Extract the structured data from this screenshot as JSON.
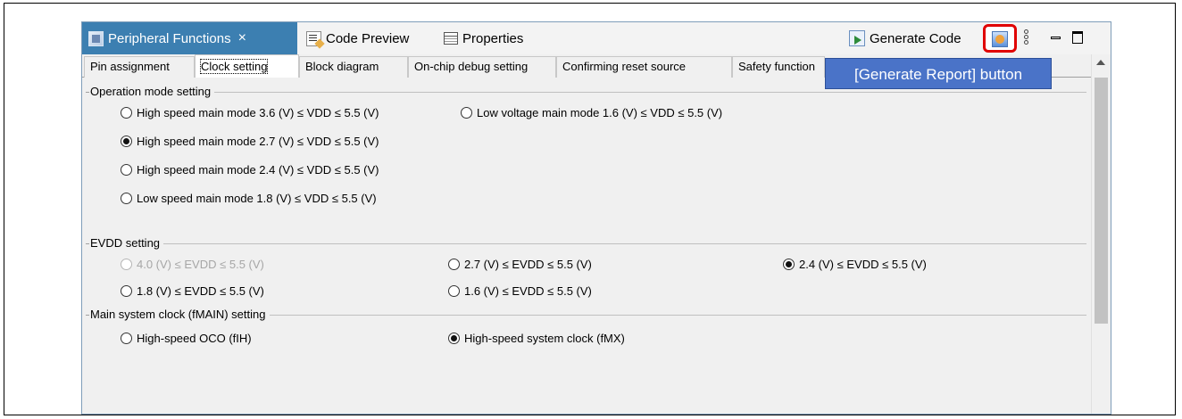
{
  "view_tabs": {
    "peripheral_functions": "Peripheral Functions",
    "close_glyph": "×",
    "code_preview": "Code Preview",
    "properties": "Properties"
  },
  "toolbar": {
    "generate_code": "Generate Code"
  },
  "tooltip": "[Generate Report] button",
  "inner_tabs": [
    {
      "label": "Pin assignment"
    },
    {
      "label": "Clock setting",
      "active": true
    },
    {
      "label": "Block diagram"
    },
    {
      "label": "On-chip debug setting"
    },
    {
      "label": "Confirming reset source"
    },
    {
      "label": "Safety function"
    }
  ],
  "groups": {
    "operation_mode": {
      "title": "Operation mode setting",
      "options": [
        {
          "label": "High speed main mode 3.6 (V) ≤ VDD ≤ 5.5 (V)",
          "checked": false
        },
        {
          "label": "Low voltage main mode 1.6 (V) ≤ VDD ≤ 5.5 (V)",
          "checked": false
        },
        {
          "label": "High speed main mode 2.7 (V) ≤ VDD ≤ 5.5 (V)",
          "checked": true
        },
        {
          "label": "High speed main mode 2.4 (V) ≤ VDD ≤ 5.5 (V)",
          "checked": false
        },
        {
          "label": "Low speed main mode 1.8 (V) ≤ VDD ≤ 5.5 (V)",
          "checked": false
        }
      ]
    },
    "evdd": {
      "title": "EVDD setting",
      "options": [
        {
          "label": "4.0 (V) ≤ EVDD ≤ 5.5 (V)",
          "checked": false,
          "disabled": true
        },
        {
          "label": "2.7 (V) ≤ EVDD ≤ 5.5 (V)",
          "checked": false
        },
        {
          "label": "2.4 (V) ≤ EVDD ≤ 5.5 (V)",
          "checked": true
        },
        {
          "label": "1.8 (V) ≤ EVDD ≤ 5.5 (V)",
          "checked": false
        },
        {
          "label": "1.6 (V) ≤ EVDD ≤ 5.5 (V)",
          "checked": false
        }
      ]
    },
    "main_clock": {
      "title": "Main system clock (fMAIN) setting",
      "options": [
        {
          "label": "High-speed OCO (fIH)",
          "checked": false
        },
        {
          "label": "High-speed system clock (fMX)",
          "checked": true
        }
      ]
    }
  }
}
